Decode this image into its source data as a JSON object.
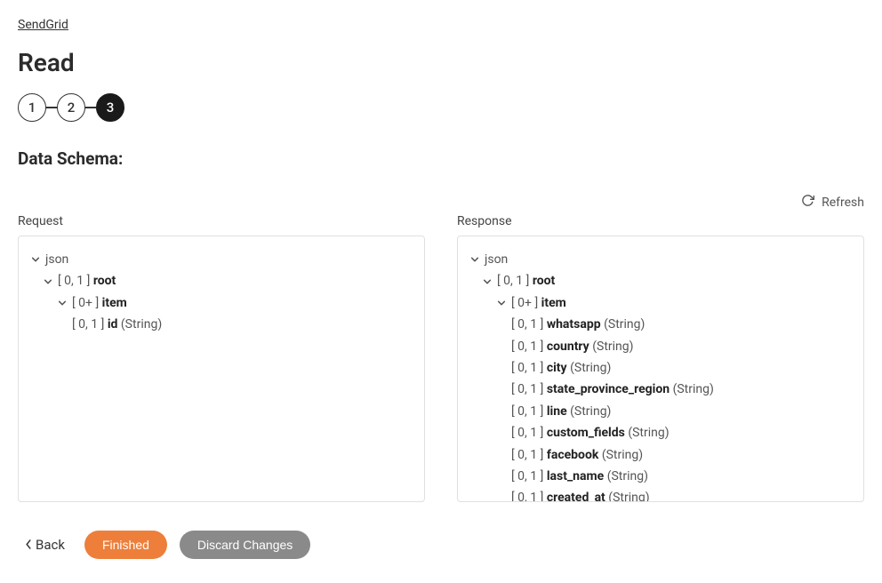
{
  "breadcrumb": {
    "label": "SendGrid"
  },
  "page_title": "Read",
  "stepper": {
    "steps": [
      "1",
      "2",
      "3"
    ],
    "active_index": 2
  },
  "section_title": "Data Schema:",
  "refresh_label": "Refresh",
  "request": {
    "label": "Request",
    "tree": [
      {
        "indent": 0,
        "chevron": true,
        "cardinality": "",
        "name": "json",
        "type": ""
      },
      {
        "indent": 1,
        "chevron": true,
        "cardinality": "[ 0, 1 ]",
        "name": "root",
        "type": ""
      },
      {
        "indent": 2,
        "chevron": true,
        "cardinality": "[ 0+ ]",
        "name": "item",
        "type": ""
      },
      {
        "indent": 3,
        "chevron": false,
        "cardinality": "[ 0, 1 ]",
        "name": "id",
        "type": "(String)"
      }
    ]
  },
  "response": {
    "label": "Response",
    "tree": [
      {
        "indent": 0,
        "chevron": true,
        "cardinality": "",
        "name": "json",
        "type": ""
      },
      {
        "indent": 1,
        "chevron": true,
        "cardinality": "[ 0, 1 ]",
        "name": "root",
        "type": ""
      },
      {
        "indent": 2,
        "chevron": true,
        "cardinality": "[ 0+ ]",
        "name": "item",
        "type": ""
      },
      {
        "indent": 3,
        "chevron": false,
        "cardinality": "[ 0, 1 ]",
        "name": "whatsapp",
        "type": "(String)"
      },
      {
        "indent": 3,
        "chevron": false,
        "cardinality": "[ 0, 1 ]",
        "name": "country",
        "type": "(String)"
      },
      {
        "indent": 3,
        "chevron": false,
        "cardinality": "[ 0, 1 ]",
        "name": "city",
        "type": "(String)"
      },
      {
        "indent": 3,
        "chevron": false,
        "cardinality": "[ 0, 1 ]",
        "name": "state_province_region",
        "type": "(String)"
      },
      {
        "indent": 3,
        "chevron": false,
        "cardinality": "[ 0, 1 ]",
        "name": "line",
        "type": "(String)"
      },
      {
        "indent": 3,
        "chevron": false,
        "cardinality": "[ 0, 1 ]",
        "name": "custom_fields",
        "type": "(String)"
      },
      {
        "indent": 3,
        "chevron": false,
        "cardinality": "[ 0, 1 ]",
        "name": "facebook",
        "type": "(String)"
      },
      {
        "indent": 3,
        "chevron": false,
        "cardinality": "[ 0, 1 ]",
        "name": "last_name",
        "type": "(String)"
      },
      {
        "indent": 3,
        "chevron": false,
        "cardinality": "[ 0, 1 ]",
        "name": "created_at",
        "type": "(String)"
      }
    ]
  },
  "footer": {
    "back_label": "Back",
    "finished_label": "Finished",
    "discard_label": "Discard Changes"
  }
}
